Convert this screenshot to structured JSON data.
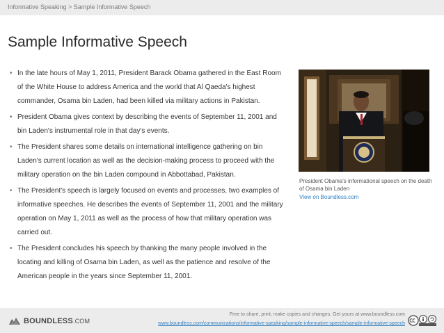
{
  "breadcrumb": "Informative Speaking > Sample Informative Speech",
  "title": "Sample Informative Speech",
  "bullets": [
    "In the late hours of May 1, 2011, President Barack Obama gathered in the East Room of the White House to address America and the world that Al Qaeda's highest commander, Osama bin Laden, had been killed via military actions in Pakistan.",
    "President Obama gives context by describing the events of September 11, 2001 and bin Laden's instrumental role in that day's events.",
    "The President shares some details on international intelligence gathering on bin Laden's current location as well as the decision-making process to proceed with the military operation on the bin Laden compound in Abbottabad, Pakistan.",
    "The President's speech is largely focused on events and processes, two examples of informative speeches. He describes the events of September 11, 2001 and the military operation on May 1, 2011 as well as the process of how that military operation was carried out.",
    "The President concludes his speech by thanking the many people involved in the locating and killing of Osama bin Laden, as well as the patience and resolve of the American people in the years since September 11, 2001."
  ],
  "bullet_glyph": "•",
  "image": {
    "caption": "President Obama's informational speech on the death of Osama bin Laden",
    "link": "View on Boundless.com"
  },
  "footer": {
    "logo_main": "BOUNDLESS",
    "logo_suffix": ".COM",
    "notice": "Free to share, print, make copies and changes. Get yours at www.boundless.com",
    "url": "www.boundless.com/communications/informative-speaking/sample-informative-speech/sample-informative-speech",
    "license_icon": "cc-by-sa-icon"
  }
}
